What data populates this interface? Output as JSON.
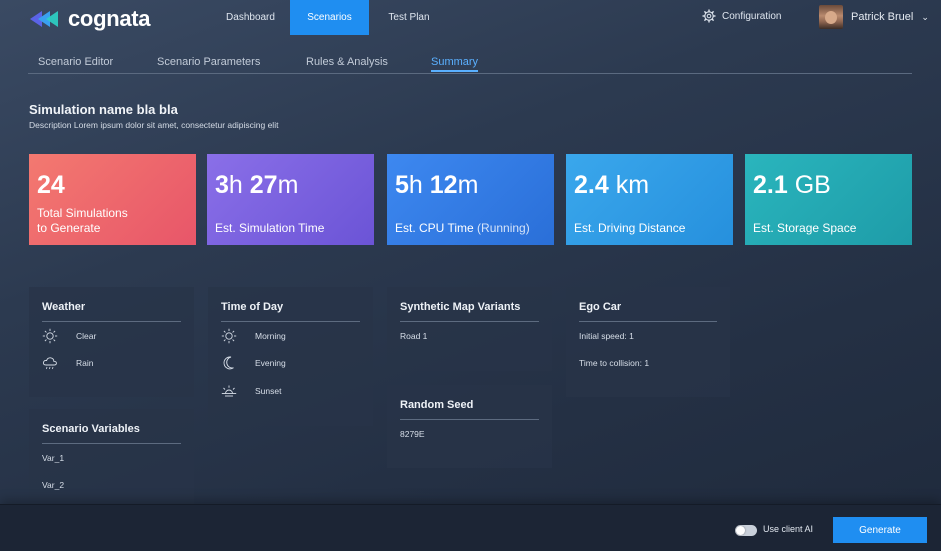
{
  "app": {
    "name": "cognata"
  },
  "nav": {
    "items": [
      "Dashboard",
      "Scenarios",
      "Test Plan"
    ],
    "active": "Scenarios"
  },
  "header": {
    "config_label": "Configuration",
    "user_name": "Patrick Bruel"
  },
  "subtabs": {
    "items": [
      "Scenario Editor",
      "Scenario Parameters",
      "Rules & Analysis",
      "Summary"
    ],
    "active": "Summary"
  },
  "simulation": {
    "name": "Simulation name bla bla",
    "description": "Description Lorem ipsum dolor sit amet, consectetur adipiscing elit"
  },
  "stats": [
    {
      "value": "24",
      "label_line1": "Total Simulations",
      "label_line2": "to Generate",
      "color": "#ef6b6e"
    },
    {
      "v1": "3",
      "u1": "h",
      "v2": "27",
      "u2": "m",
      "label": "Est. Simulation Time",
      "color": "#7b62e0"
    },
    {
      "v1": "5",
      "u1": "h",
      "v2": "12",
      "u2": "m",
      "label": "Est. CPU Time",
      "label_muted": "(Running)",
      "color": "#347ce6"
    },
    {
      "v1": "2.4",
      "u1": " km",
      "label": "Est. Driving Distance",
      "color": "#309ce5"
    },
    {
      "v1": "2.1",
      "u1": " GB",
      "label": "Est. Storage Space",
      "color": "#24a9b3"
    }
  ],
  "panels": {
    "weather": {
      "title": "Weather",
      "items": [
        {
          "label": "Clear",
          "icon": "sun-icon"
        },
        {
          "label": "Rain",
          "icon": "rain-cloud-icon"
        }
      ]
    },
    "scenario_variables": {
      "title": "Scenario Variables",
      "items": [
        "Var_1",
        "Var_2"
      ]
    },
    "time_of_day": {
      "title": "Time of Day",
      "items": [
        {
          "label": "Morning",
          "icon": "sun-icon"
        },
        {
          "label": "Evening",
          "icon": "moon-icon"
        },
        {
          "label": "Sunset",
          "icon": "sunset-icon"
        }
      ]
    },
    "map_variants": {
      "title": "Synthetic Map Variants",
      "items": [
        "Road 1"
      ]
    },
    "random_seed": {
      "title": "Random Seed",
      "value": "8279E"
    },
    "ego_car": {
      "title": "Ego Car",
      "items": [
        "Initial speed: 1",
        "Time to collision: 1"
      ]
    }
  },
  "footer": {
    "toggle_label": "Use client AI",
    "toggle_on": false,
    "generate_label": "Generate"
  },
  "colors": {
    "accent": "#1f8ef1",
    "active_tab": "#5ab0ff"
  }
}
